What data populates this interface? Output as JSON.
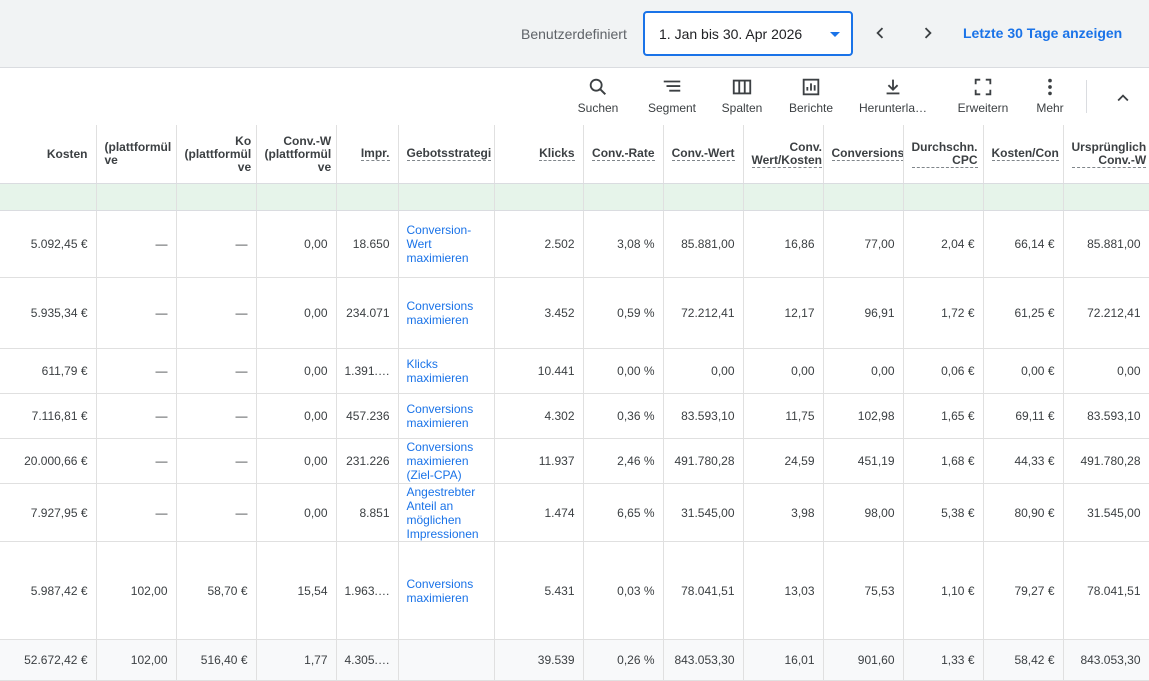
{
  "date_bar": {
    "range_label": "Benutzerdefiniert",
    "date_value": "1. Jan bis 30. Apr 2026",
    "show_last_30": "Letzte 30 Tage anzeigen"
  },
  "toolbar": {
    "items": [
      {
        "label": "Suchen",
        "icon": "search-icon"
      },
      {
        "label": "Segment",
        "icon": "segment-icon"
      },
      {
        "label": "Spalten",
        "icon": "columns-icon"
      },
      {
        "label": "Berichte",
        "icon": "reports-icon"
      },
      {
        "label": "Herunterla…",
        "icon": "download-icon"
      },
      {
        "label": "Erweitern",
        "icon": "expand-icon"
      },
      {
        "label": "Mehr",
        "icon": "more-icon"
      }
    ]
  },
  "table": {
    "headers": [
      "Kosten",
      "(plattformül ve",
      "Ko (plattformül ve",
      "Conv.-W (plattformül ve",
      "Impr.",
      "Gebotsstrategi",
      "Klicks",
      "Conv.-Rate",
      "Conv.-Wert",
      "Conv. Wert/Kosten",
      "Conversions",
      "Durchschn. CPC",
      "Kosten/Con",
      "Ursprünglich Conv.-W"
    ],
    "rows": [
      [
        "5.092,45 €",
        "—",
        "—",
        "0,00",
        "18.650",
        "Conversion-Wert maximieren",
        "2.502",
        "3,08 %",
        "85.881,00",
        "16,86",
        "77,00",
        "2,04 €",
        "66,14 €",
        "85.881,00"
      ],
      [
        "5.935,34 €",
        "—",
        "—",
        "0,00",
        "234.071",
        "Conversions maximieren",
        "3.452",
        "0,59 %",
        "72.212,41",
        "12,17",
        "96,91",
        "1,72 €",
        "61,25 €",
        "72.212,41"
      ],
      [
        "611,79 €",
        "—",
        "—",
        "0,00",
        "1.391.…",
        "Klicks maximieren",
        "10.441",
        "0,00 %",
        "0,00",
        "0,00",
        "0,00",
        "0,06 €",
        "0,00 €",
        "0,00"
      ],
      [
        "7.116,81 €",
        "—",
        "—",
        "0,00",
        "457.236",
        "Conversions maximieren",
        "4.302",
        "0,36 %",
        "83.593,10",
        "11,75",
        "102,98",
        "1,65 €",
        "69,11 €",
        "83.593,10"
      ],
      [
        "20.000,66 €",
        "—",
        "—",
        "0,00",
        "231.226",
        "Conversions maximieren (Ziel-CPA)",
        "11.937",
        "2,46 %",
        "491.780,28",
        "24,59",
        "451,19",
        "1,68 €",
        "44,33 €",
        "491.780,28"
      ],
      [
        "7.927,95 €",
        "—",
        "—",
        "0,00",
        "8.851",
        "Angestrebter Anteil an möglichen Impressionen",
        "1.474",
        "6,65 %",
        "31.545,00",
        "3,98",
        "98,00",
        "5,38 €",
        "80,90 €",
        "31.545,00"
      ],
      [
        "5.987,42 €",
        "102,00",
        "58,70 €",
        "15,54",
        "1.963.…",
        "Conversions maximieren",
        "5.431",
        "0,03 %",
        "78.041,51",
        "13,03",
        "75,53",
        "1,10 €",
        "79,27 €",
        "78.041,51"
      ]
    ],
    "total": [
      "52.672,42 €",
      "102,00",
      "516,40 €",
      "1,77",
      "4.305.…",
      "",
      "39.539",
      "0,26 %",
      "843.053,30",
      "16,01",
      "901,60",
      "1,33 €",
      "58,42 €",
      "843.053,30"
    ]
  }
}
